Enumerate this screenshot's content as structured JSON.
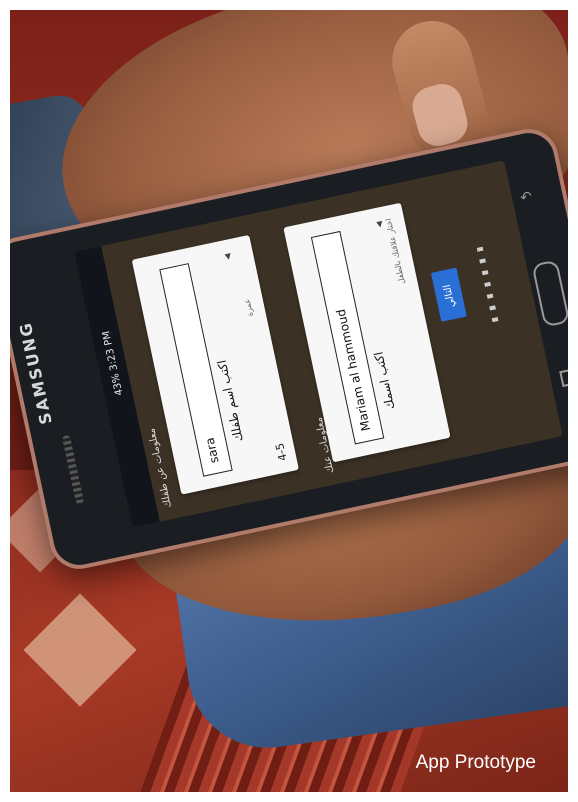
{
  "caption": "App Prototype",
  "phone": {
    "brand": "SAMSUNG",
    "status_time": "43% 3:23 PM",
    "icons": [
      "back-icon",
      "home-button",
      "recent-apps-icon"
    ],
    "screen_left_card": {
      "header": "معلومات عن طفلك",
      "prompt": "اكتب اسم طفلك",
      "name_value": "sara",
      "age_value": "4-5",
      "age_hint": "عمرة"
    },
    "screen_right_card": {
      "header": "معلومات عنك",
      "prompt": "اكتب اسمك",
      "name_value": "Mariam al hammoud",
      "relation_hint": "اختار علاقتك بالطفل"
    },
    "next_button": "التالي"
  }
}
